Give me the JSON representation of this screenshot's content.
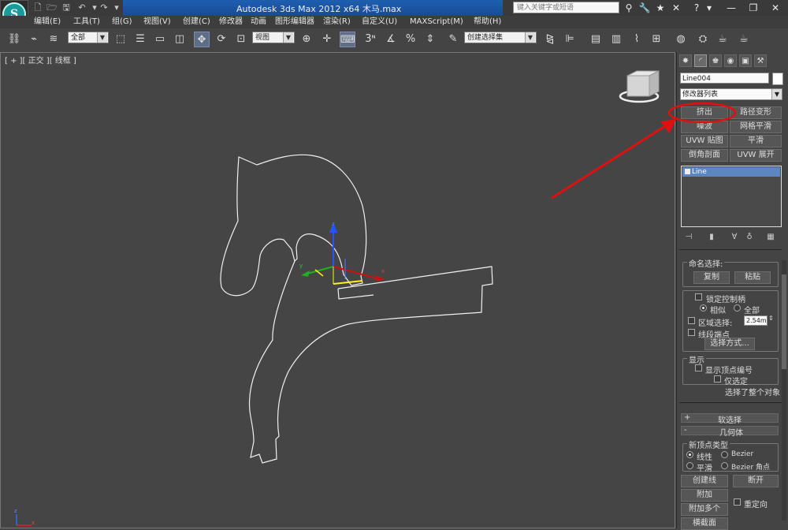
{
  "title_bar": {
    "title": "Autodesk 3ds Max  2012 x64      木马.max",
    "search_placeholder": "键入关键字或短语"
  },
  "menu": [
    "编辑(E)",
    "工具(T)",
    "组(G)",
    "视图(V)",
    "创建(C)",
    "修改器",
    "动画",
    "图形编辑器",
    "渲染(R)",
    "自定义(U)",
    "MAXScript(M)",
    "帮助(H)"
  ],
  "toolbar": {
    "selection_filter": "全部",
    "reference_coord": "视图",
    "named_selection": "创建选择集"
  },
  "viewport": {
    "label": "[ + ][ 正交 ][ 线框 ]"
  },
  "command_panel": {
    "object_name": "Line004",
    "modifier_list": "修改器列表",
    "modifier_buttons": [
      "挤出",
      "路径变形",
      "噪波",
      "网格平滑",
      "UVW 贴图",
      "平滑",
      "倒角剖面",
      "UVW 展开"
    ],
    "stack_item": "Line",
    "named_selections": {
      "title": "命名选择:",
      "copy": "复制",
      "paste": "粘贴"
    },
    "selection": {
      "lock_handles": "锁定控制柄",
      "similar": "相似",
      "all": "全部",
      "area_selection": "区域选择:",
      "area_value": "2.54m",
      "segment_end": "线段端点",
      "select_by": "选择方式..."
    },
    "display": {
      "title": "显示",
      "show_vertex_numbers": "显示顶点编号",
      "selected_only": "仅选定",
      "status": "选择了整个对象"
    },
    "soft_selection": {
      "sign": "+",
      "label": "软选择"
    },
    "geometry": {
      "sign": "-",
      "label": "几何体"
    },
    "new_vertex_type": {
      "title": "新顶点类型",
      "linear": "线性",
      "bezier": "Bezier",
      "smooth": "平滑",
      "bezier_corner": "Bezier 角点"
    },
    "geometry_buttons": {
      "create_line": "创建线",
      "break": "断开",
      "attach": "附加",
      "attach_multiple": "附加多个",
      "reorient": "重定向",
      "cross_section": "横截面"
    }
  },
  "colors": {
    "annotation_red": "#e01010",
    "stack_highlight": "#5b86c0",
    "title_blue": "#1f5fb0"
  }
}
